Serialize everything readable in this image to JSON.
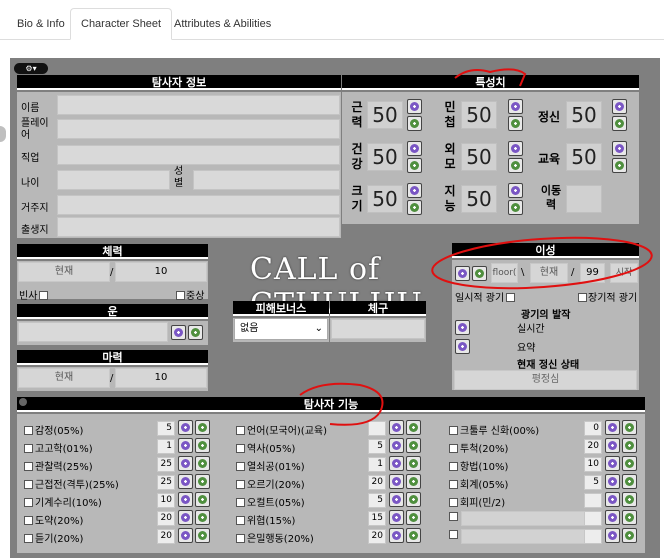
{
  "tabs": [
    {
      "label": "Bio & Info"
    },
    {
      "label": "Character Sheet"
    },
    {
      "label": "Attributes & Abilities"
    }
  ],
  "toggle": "⚙▾",
  "investigator": {
    "title": "탐사자 정보",
    "fields": [
      "이름",
      "플레이어",
      "직업",
      "나이",
      "거주지",
      "출생지"
    ],
    "sex_label": "성별"
  },
  "characteristics": {
    "title": "특성치",
    "items": [
      {
        "label": "근력",
        "value": "50"
      },
      {
        "label": "민첩",
        "value": "50"
      },
      {
        "label": "정신",
        "value": "50"
      },
      {
        "label": "건강",
        "value": "50"
      },
      {
        "label": "외모",
        "value": "50"
      },
      {
        "label": "교육",
        "value": "50"
      },
      {
        "label": "크기",
        "value": "50"
      },
      {
        "label": "지능",
        "value": "50"
      },
      {
        "label": "이동력",
        "value": ""
      }
    ]
  },
  "hp": {
    "title": "체력",
    "current": "현재",
    "sep": "/",
    "max": "10",
    "dying": "빈사",
    "major": "중상"
  },
  "luck": {
    "title": "운"
  },
  "mp": {
    "title": "마력",
    "current": "현재",
    "sep": "/",
    "max": "10"
  },
  "logo_text": "CALL of CTHULHU",
  "damage_bonus": {
    "title": "피해보너스",
    "value": "없음"
  },
  "build": {
    "title": "체구"
  },
  "sanity": {
    "title": "이성",
    "floor": "floor(",
    "sep1": "\\",
    "current": "현재",
    "sep2": "/",
    "max": "99",
    "start": "시작",
    "temp_insanity": "일시적 광기",
    "indef_insanity": "장기적 광기",
    "bout_title": "광기의 발작",
    "realtime": "실시간",
    "summary": "요약",
    "current_state": "현재 정신 상태",
    "state_value": "평정심"
  },
  "skills": {
    "title": "탐사자 기능",
    "col1": [
      {
        "label": "감정(05%)",
        "value": "5"
      },
      {
        "label": "고고학(01%)",
        "value": "1"
      },
      {
        "label": "관찰력(25%)",
        "value": "25"
      },
      {
        "label": "근접전(격투)(25%)",
        "value": "25"
      },
      {
        "label": "기계수리(10%)",
        "value": "10"
      },
      {
        "label": "도약(20%)",
        "value": "20"
      },
      {
        "label": "듣기(20%)",
        "value": "20"
      }
    ],
    "col2": [
      {
        "label": "언어(모국어)(교육)",
        "value": ""
      },
      {
        "label": "역사(05%)",
        "value": "5"
      },
      {
        "label": "열쇠공(01%)",
        "value": "1"
      },
      {
        "label": "오르기(20%)",
        "value": "20"
      },
      {
        "label": "오컬트(05%)",
        "value": "5"
      },
      {
        "label": "위협(15%)",
        "value": "15"
      },
      {
        "label": "은밀행동(20%)",
        "value": "20"
      }
    ],
    "col3": [
      {
        "label": "크툴루 신화(00%)",
        "value": "0"
      },
      {
        "label": "투척(20%)",
        "value": "20"
      },
      {
        "label": "항법(10%)",
        "value": "10"
      },
      {
        "label": "회계(05%)",
        "value": "5"
      },
      {
        "label": "회피(민/2)",
        "value": ""
      },
      {
        "label": "",
        "value": ""
      },
      {
        "label": "",
        "value": ""
      }
    ]
  }
}
